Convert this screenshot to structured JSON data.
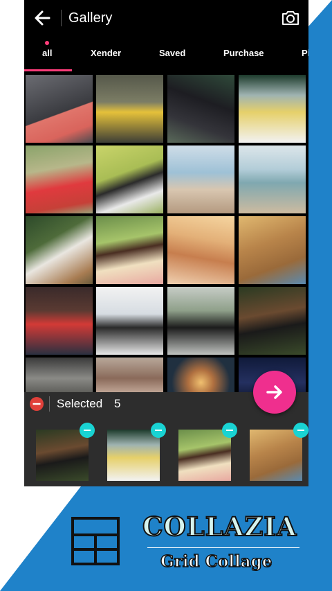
{
  "app_bar": {
    "title": "Gallery"
  },
  "tabs": [
    {
      "label": "all"
    },
    {
      "label": "Xender"
    },
    {
      "label": "Saved"
    },
    {
      "label": "Purchase"
    },
    {
      "label": "Pi"
    }
  ],
  "selection": {
    "label": "Selected",
    "count": "5"
  },
  "branding": {
    "title": "COLLAZIA",
    "subtitle": "Grid Collage"
  },
  "colors": {
    "accent": "#ef2f8e",
    "tab_indicator": "#ff3d7a",
    "remove_badge": "#19d3d3",
    "brand_blue": "#1f82c9"
  }
}
